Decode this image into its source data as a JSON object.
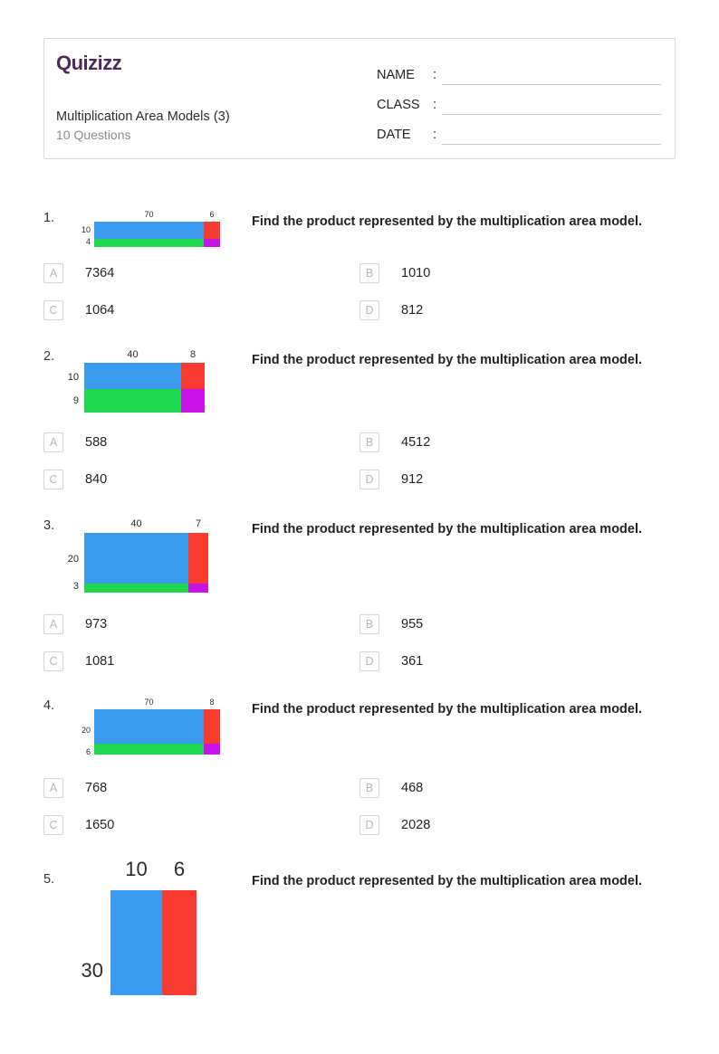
{
  "header": {
    "logo_text": "Quizizz",
    "title": "Multiplication Area Models (3)",
    "question_count": "10 Questions",
    "fields": [
      {
        "label": "NAME",
        "colon": ":",
        "value": ""
      },
      {
        "label": "CLASS",
        "colon": ":",
        "value": ""
      },
      {
        "label": "DATE",
        "colon": ":",
        "value": ""
      }
    ]
  },
  "colors": {
    "blue": "#3b9bef",
    "green": "#1ed94e",
    "red": "#f93a30",
    "purple": "#c814e8",
    "brand": "#4b2a56",
    "box_border": "#d5d5d5",
    "letter": "#b8b8b8"
  },
  "question_prompt": "Find the product represented by the multiplication area model.",
  "questions": [
    {
      "number": "1.",
      "prompt": "Find the product represented by the multiplication area model.",
      "model": {
        "top_left": "70",
        "top_right": "6",
        "left_top": "10",
        "left_bottom": "4",
        "label_size": "9px"
      },
      "options": [
        {
          "letter": "A",
          "text": "7364"
        },
        {
          "letter": "B",
          "text": "1010"
        },
        {
          "letter": "C",
          "text": "1064"
        },
        {
          "letter": "D",
          "text": "812"
        }
      ]
    },
    {
      "number": "2.",
      "prompt": "Find the product represented by the multiplication area model.",
      "model": {
        "top_left": "40",
        "top_right": "8",
        "left_top": "10",
        "left_bottom": "9",
        "label_size": "11px"
      },
      "options": [
        {
          "letter": "A",
          "text": "588"
        },
        {
          "letter": "B",
          "text": "4512"
        },
        {
          "letter": "C",
          "text": "840"
        },
        {
          "letter": "D",
          "text": "912"
        }
      ]
    },
    {
      "number": "3.",
      "prompt": "Find the product represented by the multiplication area model.",
      "model": {
        "top_left": "40",
        "top_right": "7",
        "left_top": "20",
        "left_bottom": "3",
        "label_size": "11px"
      },
      "options": [
        {
          "letter": "A",
          "text": "973"
        },
        {
          "letter": "B",
          "text": "955"
        },
        {
          "letter": "C",
          "text": "1081"
        },
        {
          "letter": "D",
          "text": "361"
        }
      ]
    },
    {
      "number": "4.",
      "prompt": "Find the product represented by the multiplication area model.",
      "model": {
        "top_left": "70",
        "top_right": "8",
        "left_top": "20",
        "left_bottom": "6",
        "label_size": "9px"
      },
      "options": [
        {
          "letter": "A",
          "text": "768"
        },
        {
          "letter": "B",
          "text": "468"
        },
        {
          "letter": "C",
          "text": "1650"
        },
        {
          "letter": "D",
          "text": "2028"
        }
      ]
    },
    {
      "number": "5.",
      "prompt": "Find the product represented by the multiplication area model.",
      "model": {
        "top_left": "10",
        "top_right": "6",
        "left_top": "30",
        "left_bottom": "",
        "label_size": "22px"
      },
      "options": []
    }
  ]
}
